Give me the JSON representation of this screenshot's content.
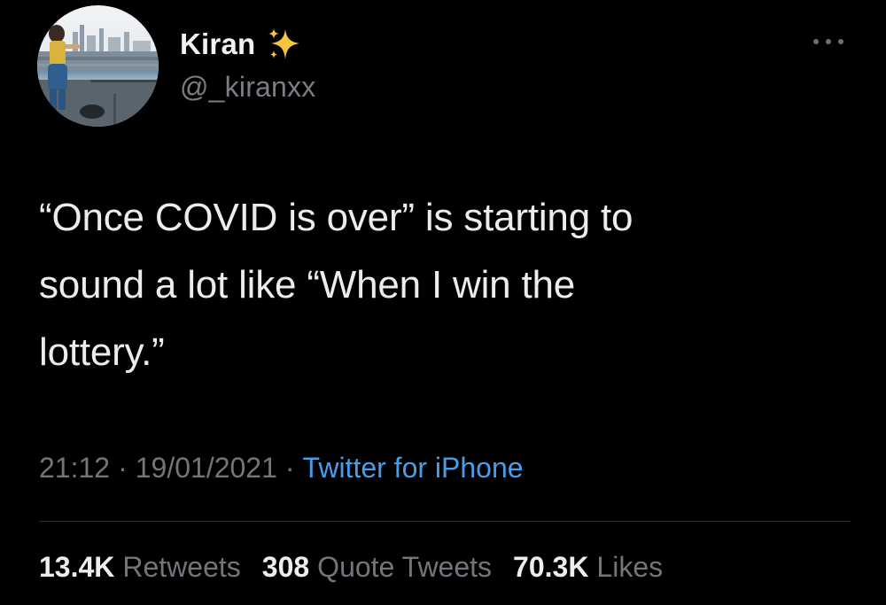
{
  "author": {
    "display_name": "Kiran",
    "handle": "@_kiranxx",
    "badge_icon": "sparkles-icon"
  },
  "tweet": {
    "text": "“Once COVID is over” is starting to\nsound a lot like “When I win the\nlottery.”"
  },
  "meta": {
    "time": "21:12",
    "date": "19/01/2021",
    "separator": "·",
    "source": "Twitter for iPhone"
  },
  "stats": {
    "retweets_count": "13.4K",
    "retweets_label": "Retweets",
    "quotes_count": "308",
    "quotes_label": "Quote Tweets",
    "likes_count": "70.3K",
    "likes_label": "Likes"
  },
  "colors": {
    "background": "#000000",
    "text_primary": "#ececec",
    "text_secondary": "#72767b",
    "link": "#4a9ce8",
    "sparkle": "#f5c542"
  }
}
